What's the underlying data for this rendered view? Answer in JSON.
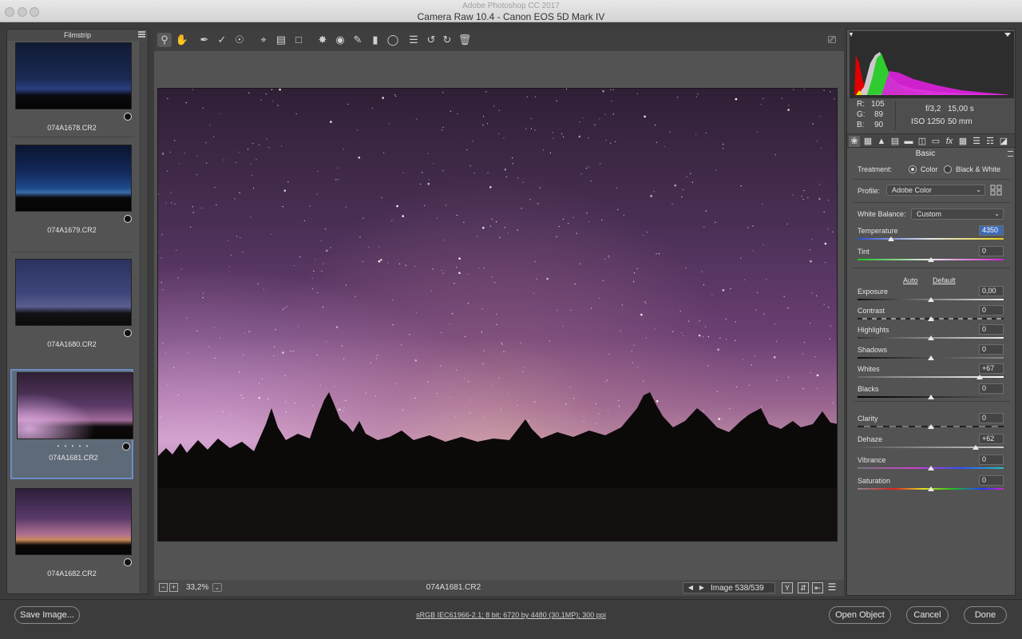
{
  "window": {
    "app_title": "Adobe Photoshop CC 2017",
    "title": "Camera Raw 10.4  -  Canon EOS 5D Mark IV"
  },
  "filmstrip": {
    "title": "Filmstrip",
    "items": [
      {
        "label": "074A1678.CR2",
        "selected": false
      },
      {
        "label": "074A1679.CR2",
        "selected": false
      },
      {
        "label": "074A1680.CR2",
        "selected": false
      },
      {
        "label": "074A1681.CR2",
        "selected": true,
        "rating_dots": "• • • • •"
      },
      {
        "label": "074A1682.CR2",
        "selected": false
      }
    ]
  },
  "toolbar": {
    "tools": [
      "zoom-icon",
      "hand-icon",
      "white-balance-icon",
      "color-sampler-icon",
      "targeted-adjustment-icon",
      "crop-icon",
      "straighten-icon",
      "transform-icon",
      "spot-removal-icon",
      "red-eye-icon",
      "adjustment-brush-icon",
      "graduated-filter-icon",
      "radial-filter-icon",
      "preferences-icon",
      "rotate-left-icon",
      "rotate-right-icon",
      "trash-icon"
    ],
    "fullscreen_icon": "fullscreen-icon"
  },
  "canvas": {
    "zoom": "33,2%",
    "filename": "074A1681.CR2",
    "image_count": "Image 538/539",
    "view_buttons": [
      "Y"
    ]
  },
  "readout": {
    "r_label": "R:",
    "r": "105",
    "g_label": "G:",
    "g": "89",
    "b_label": "B:",
    "b": "90",
    "aperture": "f/3,2",
    "shutter": "15,00 s",
    "iso": "ISO 1250",
    "focal": "50 mm"
  },
  "panel": {
    "title": "Basic",
    "treatment_label": "Treatment:",
    "treatment_color": "Color",
    "treatment_bw": "Black & White",
    "profile_label": "Profile:",
    "profile_value": "Adobe Color",
    "wb_label": "White Balance:",
    "wb_value": "Custom",
    "auto": "Auto",
    "default": "Default",
    "sliders": {
      "temperature": {
        "label": "Temperature",
        "value": "4350",
        "position": 0.23
      },
      "tint": {
        "label": "Tint",
        "value": "0",
        "position": 0.5
      },
      "exposure": {
        "label": "Exposure",
        "value": "0,00",
        "position": 0.5
      },
      "contrast": {
        "label": "Contrast",
        "value": "0",
        "position": 0.5
      },
      "highlights": {
        "label": "Highlights",
        "value": "0",
        "position": 0.5
      },
      "shadows": {
        "label": "Shadows",
        "value": "0",
        "position": 0.5
      },
      "whites": {
        "label": "Whites",
        "value": "+67",
        "position": 0.835
      },
      "blacks": {
        "label": "Blacks",
        "value": "0",
        "position": 0.5
      },
      "clarity": {
        "label": "Clarity",
        "value": "0",
        "position": 0.5
      },
      "dehaze": {
        "label": "Dehaze",
        "value": "+62",
        "position": 0.81
      },
      "vibrance": {
        "label": "Vibrance",
        "value": "0",
        "position": 0.5
      },
      "saturation": {
        "label": "Saturation",
        "value": "0",
        "position": 0.5
      }
    }
  },
  "footer": {
    "save_image": "Save Image...",
    "workflow": "sRGB IEC61966-2.1; 8 bit; 6720 by 4480 (30,1MP); 300 ppi",
    "open_object": "Open Object",
    "cancel": "Cancel",
    "done": "Done"
  }
}
